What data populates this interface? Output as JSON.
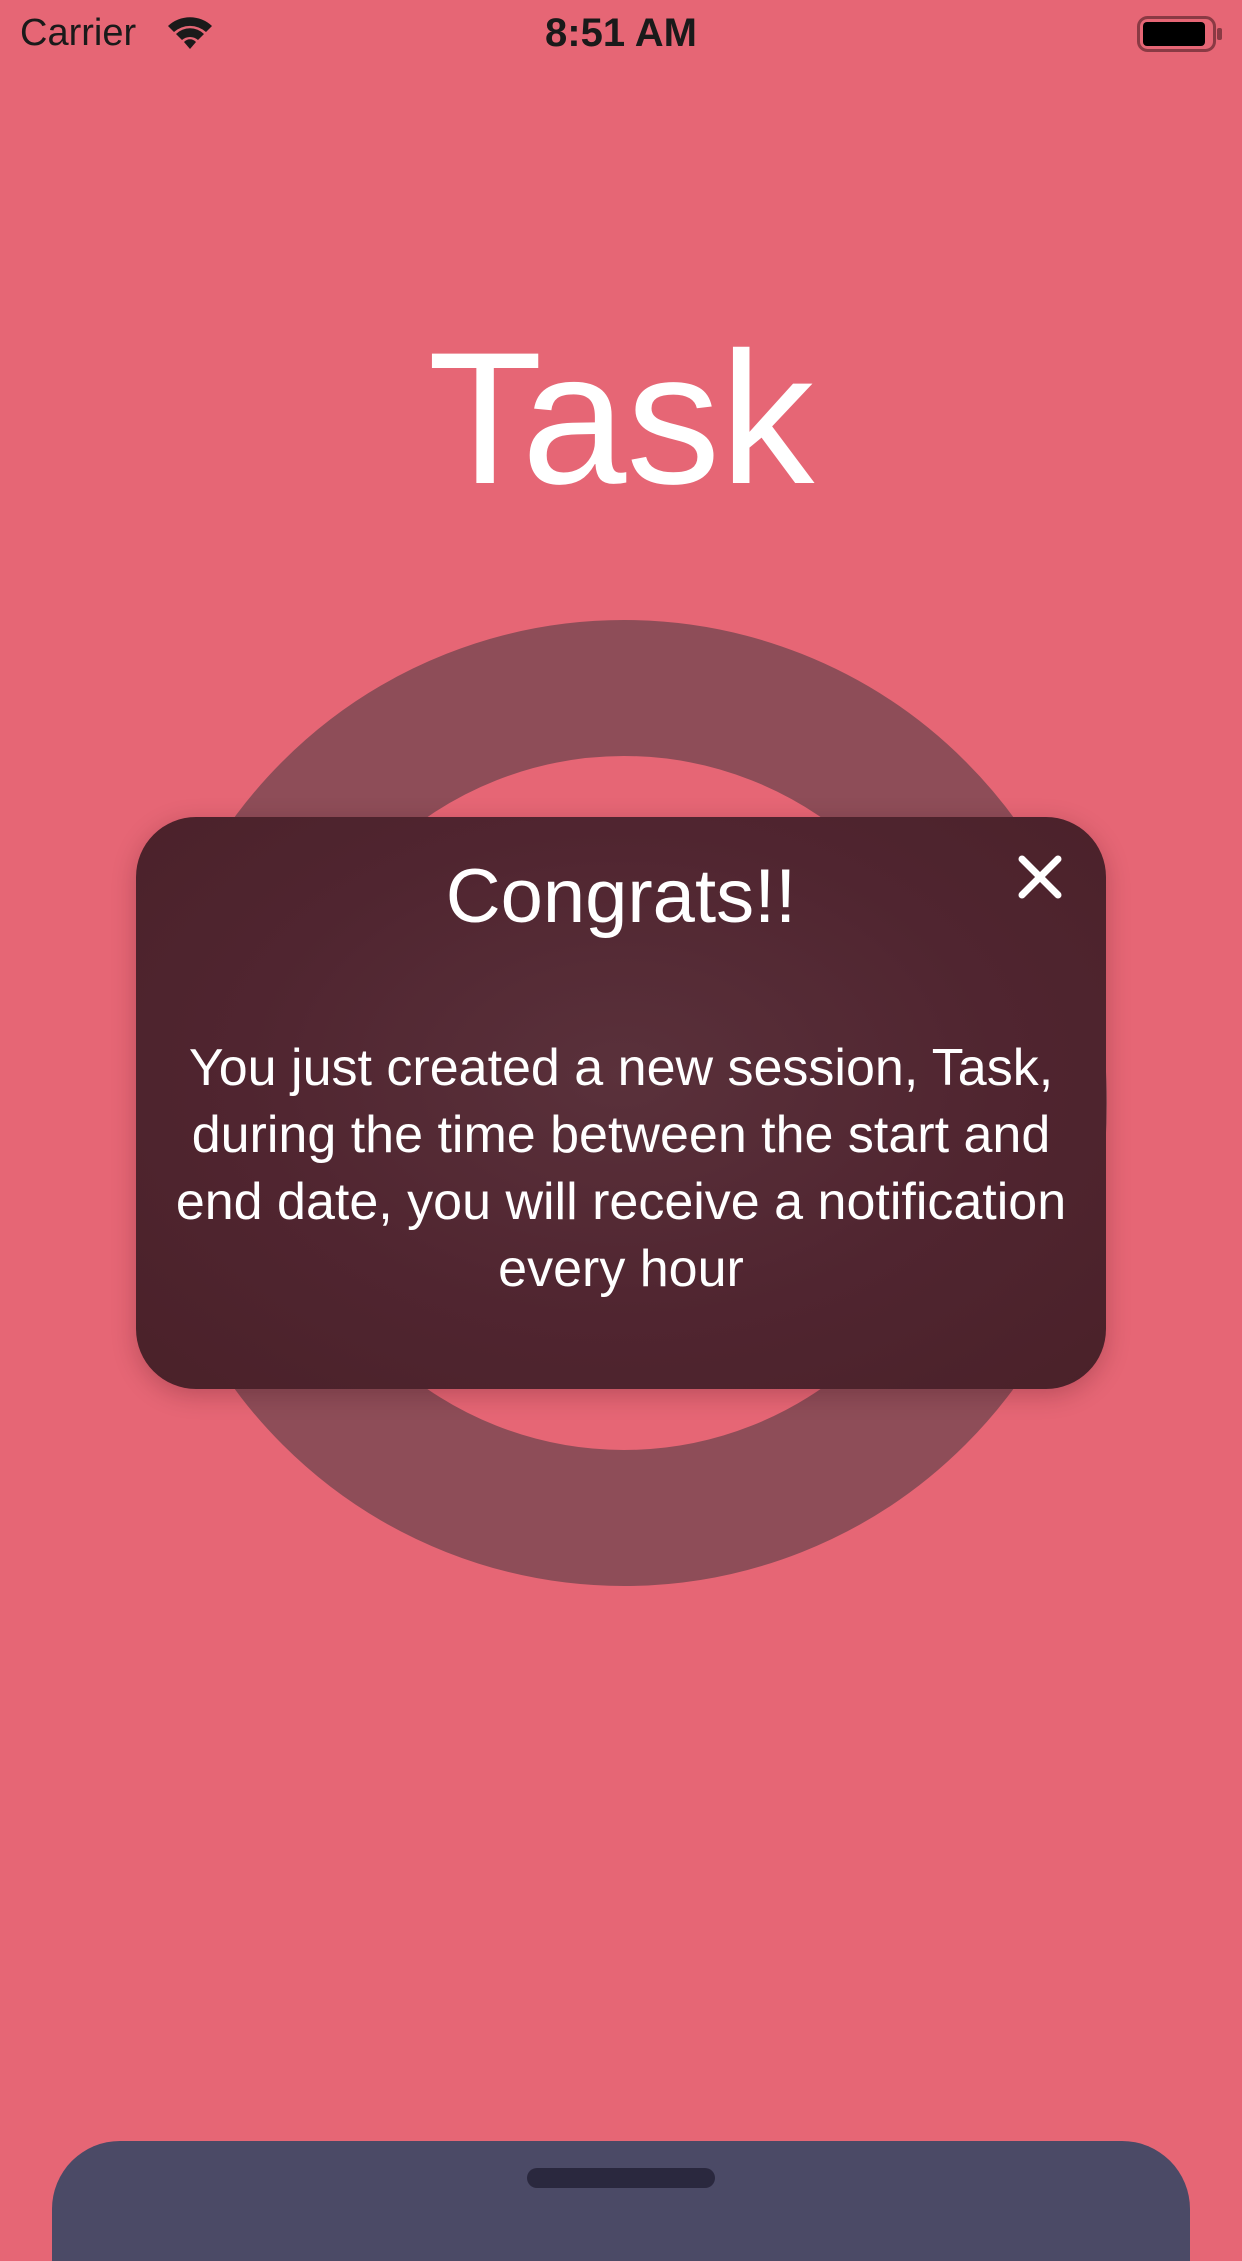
{
  "status_bar": {
    "carrier": "Carrier",
    "time": "8:51 AM",
    "wifi_icon": "wifi-icon",
    "battery_icon": "battery-icon"
  },
  "screen": {
    "title": "Task"
  },
  "popup": {
    "title": "Congrats!!",
    "message": "You just created a new session, Task, during the time between the start and end date, you will receive a notification every hour",
    "close_icon": "close-icon"
  },
  "colors": {
    "background": "#e66675",
    "ring": "#8e4d58",
    "popup_background": "#502530",
    "bottom_sheet": "#4b4a66",
    "text": "#ffffff"
  }
}
